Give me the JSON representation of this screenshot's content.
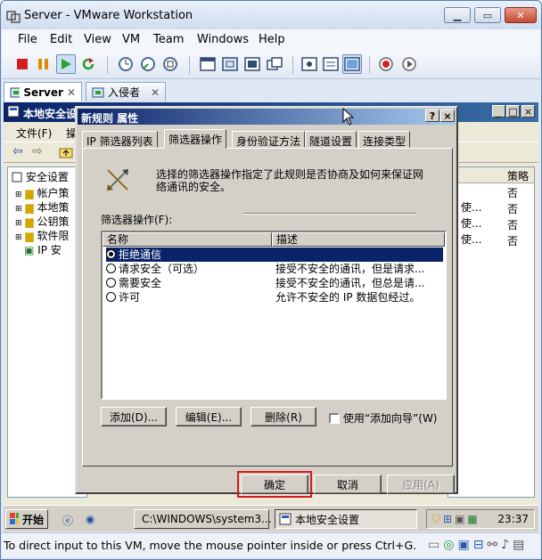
{
  "vmware": {
    "title": "Server - VMware Workstation",
    "menu": [
      "File",
      "Edit",
      "View",
      "VM",
      "Team",
      "Windows",
      "Help"
    ],
    "tabs": [
      {
        "label": "Server",
        "active": true
      },
      {
        "label": "入侵者",
        "active": false
      }
    ],
    "status_text": "To direct input to this VM, move the mouse pointer inside or press Ctrl+G."
  },
  "mmc": {
    "title": "本地安全设置",
    "menu": [
      "文件(F)",
      "操"
    ],
    "tree": [
      "安全设置",
      "帐户策",
      "本地策",
      "公钥策",
      "软件限",
      "IP 安"
    ],
    "list_header": "策略",
    "list_values": [
      "否",
      "否",
      "否",
      "否"
    ],
    "list_fragments": [
      "使...",
      "使...",
      "使..."
    ]
  },
  "dialog": {
    "title": "新规则 属性",
    "help_glyph": "?",
    "close_glyph": "×",
    "tabs": [
      "IP 筛选器列表",
      "筛选器操作",
      "身份验证方法",
      "隧道设置",
      "连接类型"
    ],
    "active_tab": 1,
    "description": "选择的筛选器操作指定了此规则是否协商及如何来保证网络通讯的安全。",
    "list_label": "筛选器操作(F):",
    "columns": [
      "名称",
      "描述"
    ],
    "rows": [
      {
        "name": "拒绝通信",
        "desc": "",
        "selected": true
      },
      {
        "name": "请求安全（可选）",
        "desc": "接受不安全的通讯，但是请求...",
        "selected": false
      },
      {
        "name": "需要安全",
        "desc": "接受不安全的通讯，但总是请...",
        "selected": false
      },
      {
        "name": "许可",
        "desc": "允许不安全的 IP 数据包经过。",
        "selected": false
      }
    ],
    "add_button": "添加(D)...",
    "edit_button": "编辑(E)...",
    "delete_button": "删除(R)",
    "wizard_checkbox": "使用“添加向导”(W)",
    "ok_button": "确定",
    "cancel_button": "取消",
    "apply_button": "应用(A)"
  },
  "taskbar": {
    "start": "开始",
    "tasks": [
      "C:\\WINDOWS\\system3...",
      "本地安全设置"
    ],
    "clock": "23:37"
  }
}
